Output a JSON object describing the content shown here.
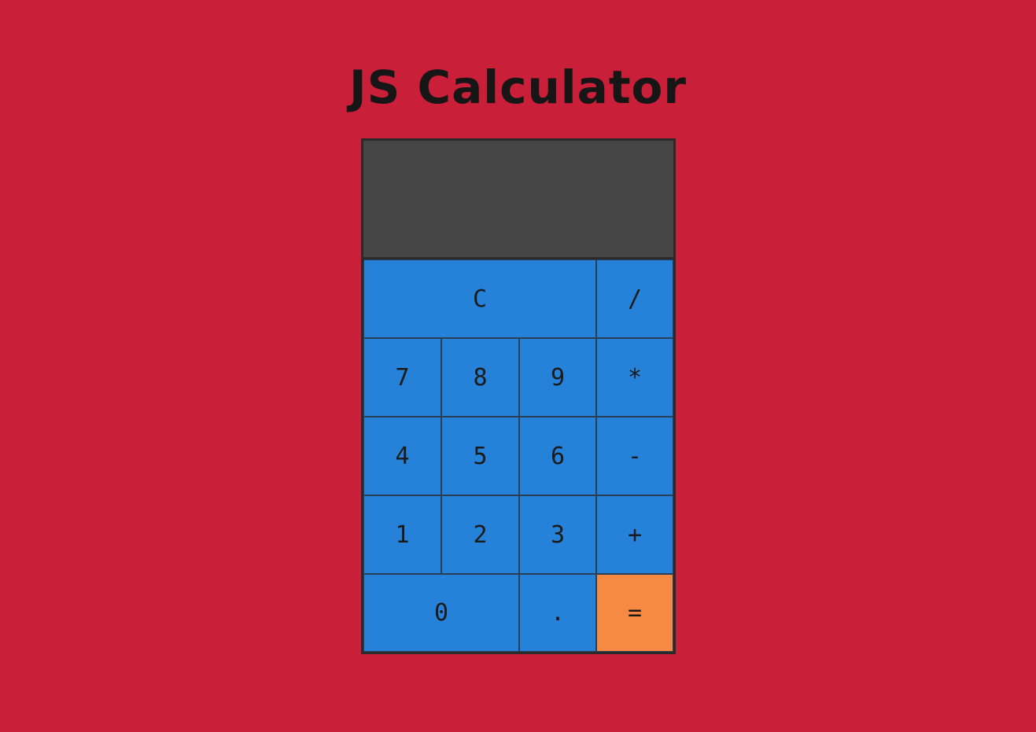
{
  "title": "JS Calculator",
  "display": {
    "value": ""
  },
  "keys": {
    "clear": "C",
    "divide": "/",
    "seven": "7",
    "eight": "8",
    "nine": "9",
    "multiply": "*",
    "four": "4",
    "five": "5",
    "six": "6",
    "subtract": "-",
    "one": "1",
    "two": "2",
    "three": "3",
    "add": "+",
    "zero": "0",
    "decimal": ".",
    "equals": "="
  },
  "colors": {
    "background": "#c91f38",
    "display": "#464646",
    "key": "#2582d8",
    "equals_key": "#f78a42"
  }
}
